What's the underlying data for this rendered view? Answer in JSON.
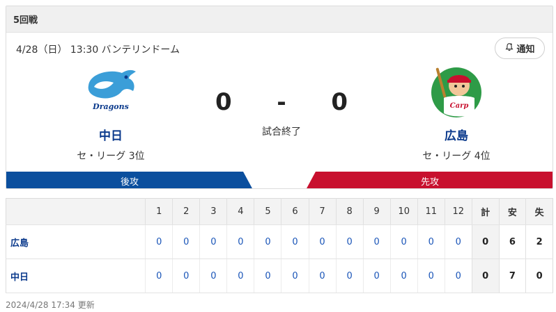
{
  "header": {
    "title": "5回戦"
  },
  "game": {
    "date_venue": "4/28（日） 13:30 バンテリンドーム",
    "status": "試合終了",
    "home_score": "0",
    "away_score": "0",
    "dash": "-"
  },
  "notify": {
    "label": "通知",
    "icon": "bell-plus-icon"
  },
  "home_team": {
    "name": "中日",
    "rank": "セ・リーグ 3位",
    "side": "後攻",
    "color": "#0b4f9e",
    "logo": "Dragons"
  },
  "away_team": {
    "name": "広島",
    "rank": "セ・リーグ 4位",
    "side": "先攻",
    "color": "#c8102e",
    "logo": "Carp"
  },
  "scoreboard": {
    "innings": [
      "1",
      "2",
      "3",
      "4",
      "5",
      "6",
      "7",
      "8",
      "9",
      "10",
      "11",
      "12"
    ],
    "totals_headers": [
      "計",
      "安",
      "失"
    ],
    "rows": [
      {
        "team": "広島",
        "scores": [
          "0",
          "0",
          "0",
          "0",
          "0",
          "0",
          "0",
          "0",
          "0",
          "0",
          "0",
          "0"
        ],
        "runs": "0",
        "hits": "6",
        "errors": "2"
      },
      {
        "team": "中日",
        "scores": [
          "0",
          "0",
          "0",
          "0",
          "0",
          "0",
          "0",
          "0",
          "0",
          "0",
          "0",
          "0"
        ],
        "runs": "0",
        "hits": "7",
        "errors": "0"
      }
    ]
  },
  "footer": {
    "updated": "2024/4/28 17:34 更新"
  }
}
